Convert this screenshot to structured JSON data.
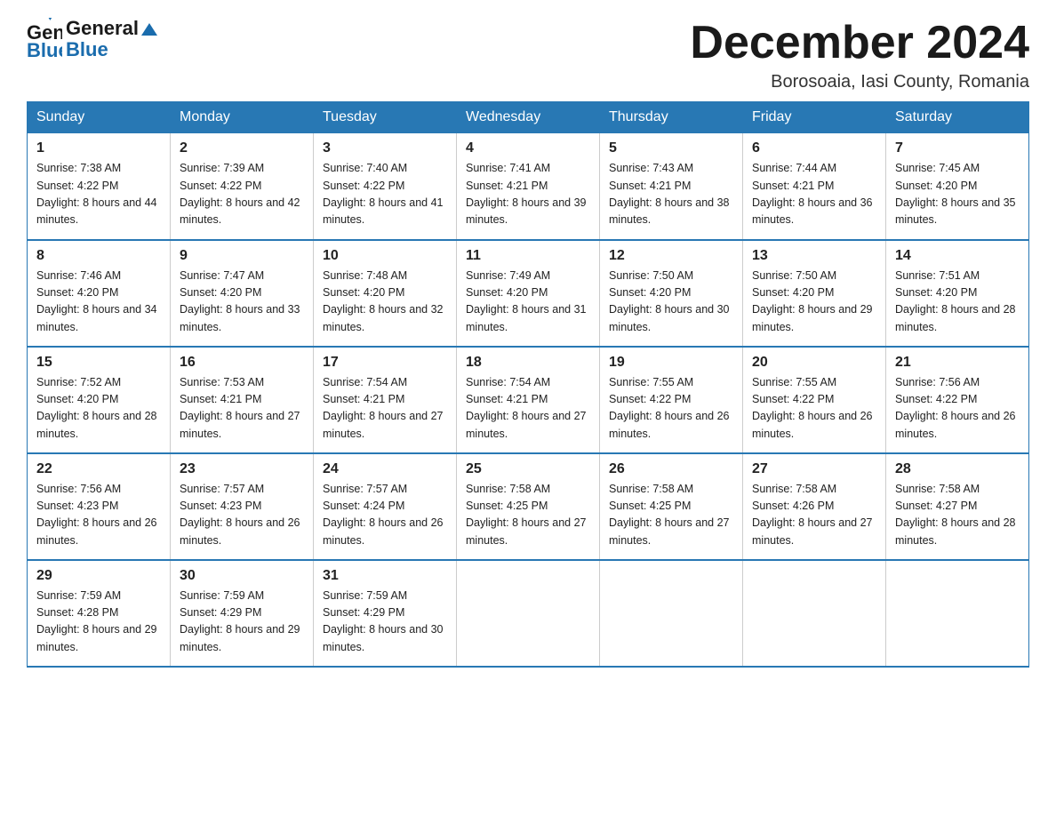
{
  "header": {
    "logo_text_general": "General",
    "logo_text_blue": "Blue",
    "month_title": "December 2024",
    "location": "Borosoaia, Iasi County, Romania"
  },
  "weekdays": [
    "Sunday",
    "Monday",
    "Tuesday",
    "Wednesday",
    "Thursday",
    "Friday",
    "Saturday"
  ],
  "weeks": [
    [
      {
        "day": "1",
        "sunrise": "7:38 AM",
        "sunset": "4:22 PM",
        "daylight": "8 hours and 44 minutes."
      },
      {
        "day": "2",
        "sunrise": "7:39 AM",
        "sunset": "4:22 PM",
        "daylight": "8 hours and 42 minutes."
      },
      {
        "day": "3",
        "sunrise": "7:40 AM",
        "sunset": "4:22 PM",
        "daylight": "8 hours and 41 minutes."
      },
      {
        "day": "4",
        "sunrise": "7:41 AM",
        "sunset": "4:21 PM",
        "daylight": "8 hours and 39 minutes."
      },
      {
        "day": "5",
        "sunrise": "7:43 AM",
        "sunset": "4:21 PM",
        "daylight": "8 hours and 38 minutes."
      },
      {
        "day": "6",
        "sunrise": "7:44 AM",
        "sunset": "4:21 PM",
        "daylight": "8 hours and 36 minutes."
      },
      {
        "day": "7",
        "sunrise": "7:45 AM",
        "sunset": "4:20 PM",
        "daylight": "8 hours and 35 minutes."
      }
    ],
    [
      {
        "day": "8",
        "sunrise": "7:46 AM",
        "sunset": "4:20 PM",
        "daylight": "8 hours and 34 minutes."
      },
      {
        "day": "9",
        "sunrise": "7:47 AM",
        "sunset": "4:20 PM",
        "daylight": "8 hours and 33 minutes."
      },
      {
        "day": "10",
        "sunrise": "7:48 AM",
        "sunset": "4:20 PM",
        "daylight": "8 hours and 32 minutes."
      },
      {
        "day": "11",
        "sunrise": "7:49 AM",
        "sunset": "4:20 PM",
        "daylight": "8 hours and 31 minutes."
      },
      {
        "day": "12",
        "sunrise": "7:50 AM",
        "sunset": "4:20 PM",
        "daylight": "8 hours and 30 minutes."
      },
      {
        "day": "13",
        "sunrise": "7:50 AM",
        "sunset": "4:20 PM",
        "daylight": "8 hours and 29 minutes."
      },
      {
        "day": "14",
        "sunrise": "7:51 AM",
        "sunset": "4:20 PM",
        "daylight": "8 hours and 28 minutes."
      }
    ],
    [
      {
        "day": "15",
        "sunrise": "7:52 AM",
        "sunset": "4:20 PM",
        "daylight": "8 hours and 28 minutes."
      },
      {
        "day": "16",
        "sunrise": "7:53 AM",
        "sunset": "4:21 PM",
        "daylight": "8 hours and 27 minutes."
      },
      {
        "day": "17",
        "sunrise": "7:54 AM",
        "sunset": "4:21 PM",
        "daylight": "8 hours and 27 minutes."
      },
      {
        "day": "18",
        "sunrise": "7:54 AM",
        "sunset": "4:21 PM",
        "daylight": "8 hours and 27 minutes."
      },
      {
        "day": "19",
        "sunrise": "7:55 AM",
        "sunset": "4:22 PM",
        "daylight": "8 hours and 26 minutes."
      },
      {
        "day": "20",
        "sunrise": "7:55 AM",
        "sunset": "4:22 PM",
        "daylight": "8 hours and 26 minutes."
      },
      {
        "day": "21",
        "sunrise": "7:56 AM",
        "sunset": "4:22 PM",
        "daylight": "8 hours and 26 minutes."
      }
    ],
    [
      {
        "day": "22",
        "sunrise": "7:56 AM",
        "sunset": "4:23 PM",
        "daylight": "8 hours and 26 minutes."
      },
      {
        "day": "23",
        "sunrise": "7:57 AM",
        "sunset": "4:23 PM",
        "daylight": "8 hours and 26 minutes."
      },
      {
        "day": "24",
        "sunrise": "7:57 AM",
        "sunset": "4:24 PM",
        "daylight": "8 hours and 26 minutes."
      },
      {
        "day": "25",
        "sunrise": "7:58 AM",
        "sunset": "4:25 PM",
        "daylight": "8 hours and 27 minutes."
      },
      {
        "day": "26",
        "sunrise": "7:58 AM",
        "sunset": "4:25 PM",
        "daylight": "8 hours and 27 minutes."
      },
      {
        "day": "27",
        "sunrise": "7:58 AM",
        "sunset": "4:26 PM",
        "daylight": "8 hours and 27 minutes."
      },
      {
        "day": "28",
        "sunrise": "7:58 AM",
        "sunset": "4:27 PM",
        "daylight": "8 hours and 28 minutes."
      }
    ],
    [
      {
        "day": "29",
        "sunrise": "7:59 AM",
        "sunset": "4:28 PM",
        "daylight": "8 hours and 29 minutes."
      },
      {
        "day": "30",
        "sunrise": "7:59 AM",
        "sunset": "4:29 PM",
        "daylight": "8 hours and 29 minutes."
      },
      {
        "day": "31",
        "sunrise": "7:59 AM",
        "sunset": "4:29 PM",
        "daylight": "8 hours and 30 minutes."
      },
      null,
      null,
      null,
      null
    ]
  ]
}
